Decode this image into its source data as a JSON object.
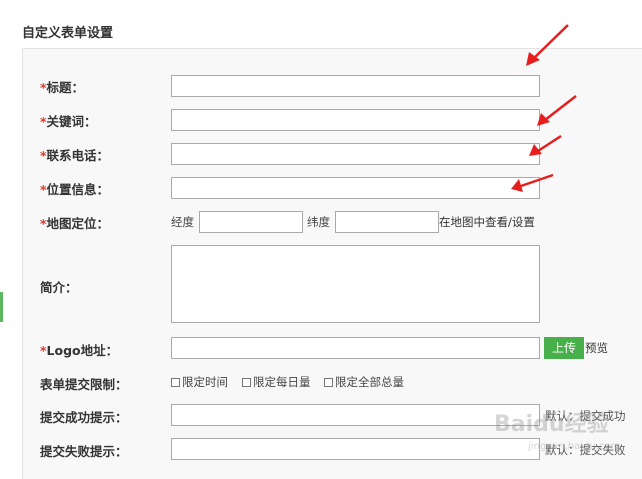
{
  "page_title": "自定义表单设置",
  "required_mark": "*",
  "accent_color": "#47b04b",
  "required_color": "#e2382b",
  "fields": {
    "title": {
      "label": "标题："
    },
    "keywords": {
      "label": "关键词："
    },
    "phone": {
      "label": "联系电话："
    },
    "location": {
      "label": "位置信息："
    },
    "map": {
      "label": "地图定位：",
      "longitude_label": "经度",
      "latitude_label": "纬度",
      "view_link": "在地图中查看/设置"
    },
    "intro": {
      "label": "简介："
    },
    "logo": {
      "label": "Logo地址：",
      "upload_button": "上传",
      "preview_link": "预览"
    },
    "limit": {
      "label": "表单提交限制：",
      "options": [
        "限定时间",
        "限定每日量",
        "限定全部总量"
      ]
    },
    "success_tip": {
      "label": "提交成功提示：",
      "hint": "默认：提交成功"
    },
    "fail_tip": {
      "label": "提交失败提示：",
      "hint": "默认：提交失败"
    }
  },
  "watermark": {
    "text": "Baidu经验",
    "url": "jingyan.baidu.com"
  },
  "annotations": {
    "arrow_icon": "red-arrow-icon"
  }
}
